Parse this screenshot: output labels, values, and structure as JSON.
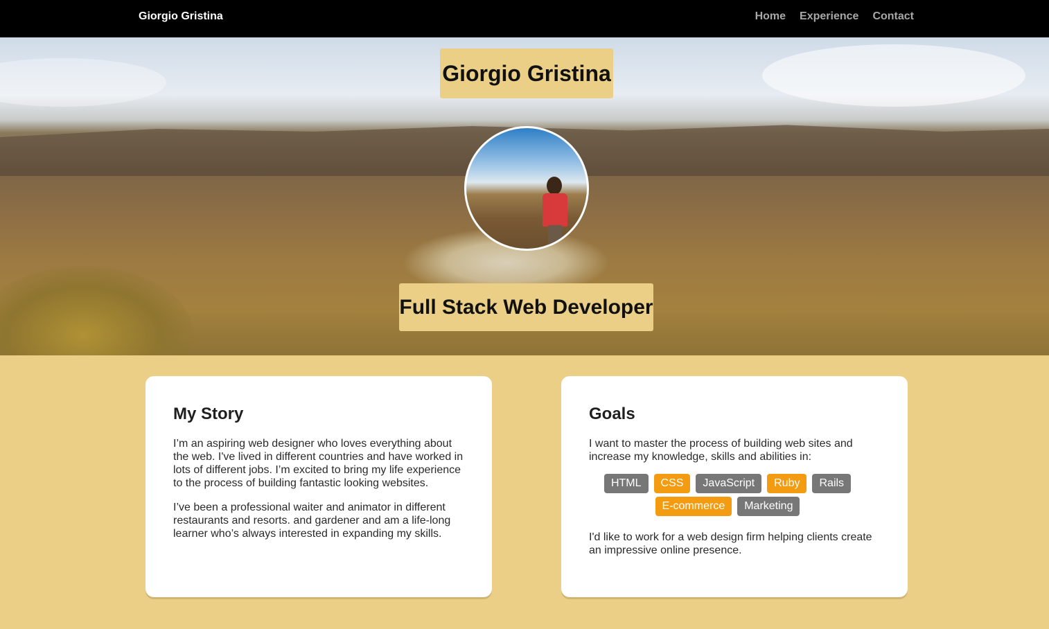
{
  "nav": {
    "brand": "Giorgio Gristina",
    "links": [
      "Home",
      "Experience",
      "Contact"
    ]
  },
  "hero": {
    "title": "Giorgio Gristina",
    "subtitle": "Full Stack Web Developer"
  },
  "story": {
    "heading": "My Story",
    "paragraphs": [
      "I’m an aspiring web designer who loves everything about the web. I've lived in different countries and have worked in lots of different jobs. I’m excited to bring my life experience to the process of building fantastic looking websites.",
      "I’ve been a professional waiter and animator in different restaurants and resorts. and gardener and am a life-long learner who’s always interested in expanding my skills."
    ]
  },
  "goals": {
    "heading": "Goals",
    "intro": "I want to master the process of building web sites and increase my knowledge, skills and abilities in:",
    "tags": [
      {
        "label": "HTML",
        "color": "grey"
      },
      {
        "label": "CSS",
        "color": "orange"
      },
      {
        "label": "JavaScript",
        "color": "grey"
      },
      {
        "label": "Ruby",
        "color": "orange"
      },
      {
        "label": "Rails",
        "color": "grey"
      },
      {
        "label": "E-commerce",
        "color": "orange"
      },
      {
        "label": "Marketing",
        "color": "grey"
      }
    ],
    "outro": "I'd like to work for a web design firm helping clients create an impressive online presence."
  },
  "colors": {
    "accent": "#ebcf87",
    "tag_grey": "#777777",
    "tag_orange": "#f39c12",
    "navbar": "#000000"
  }
}
